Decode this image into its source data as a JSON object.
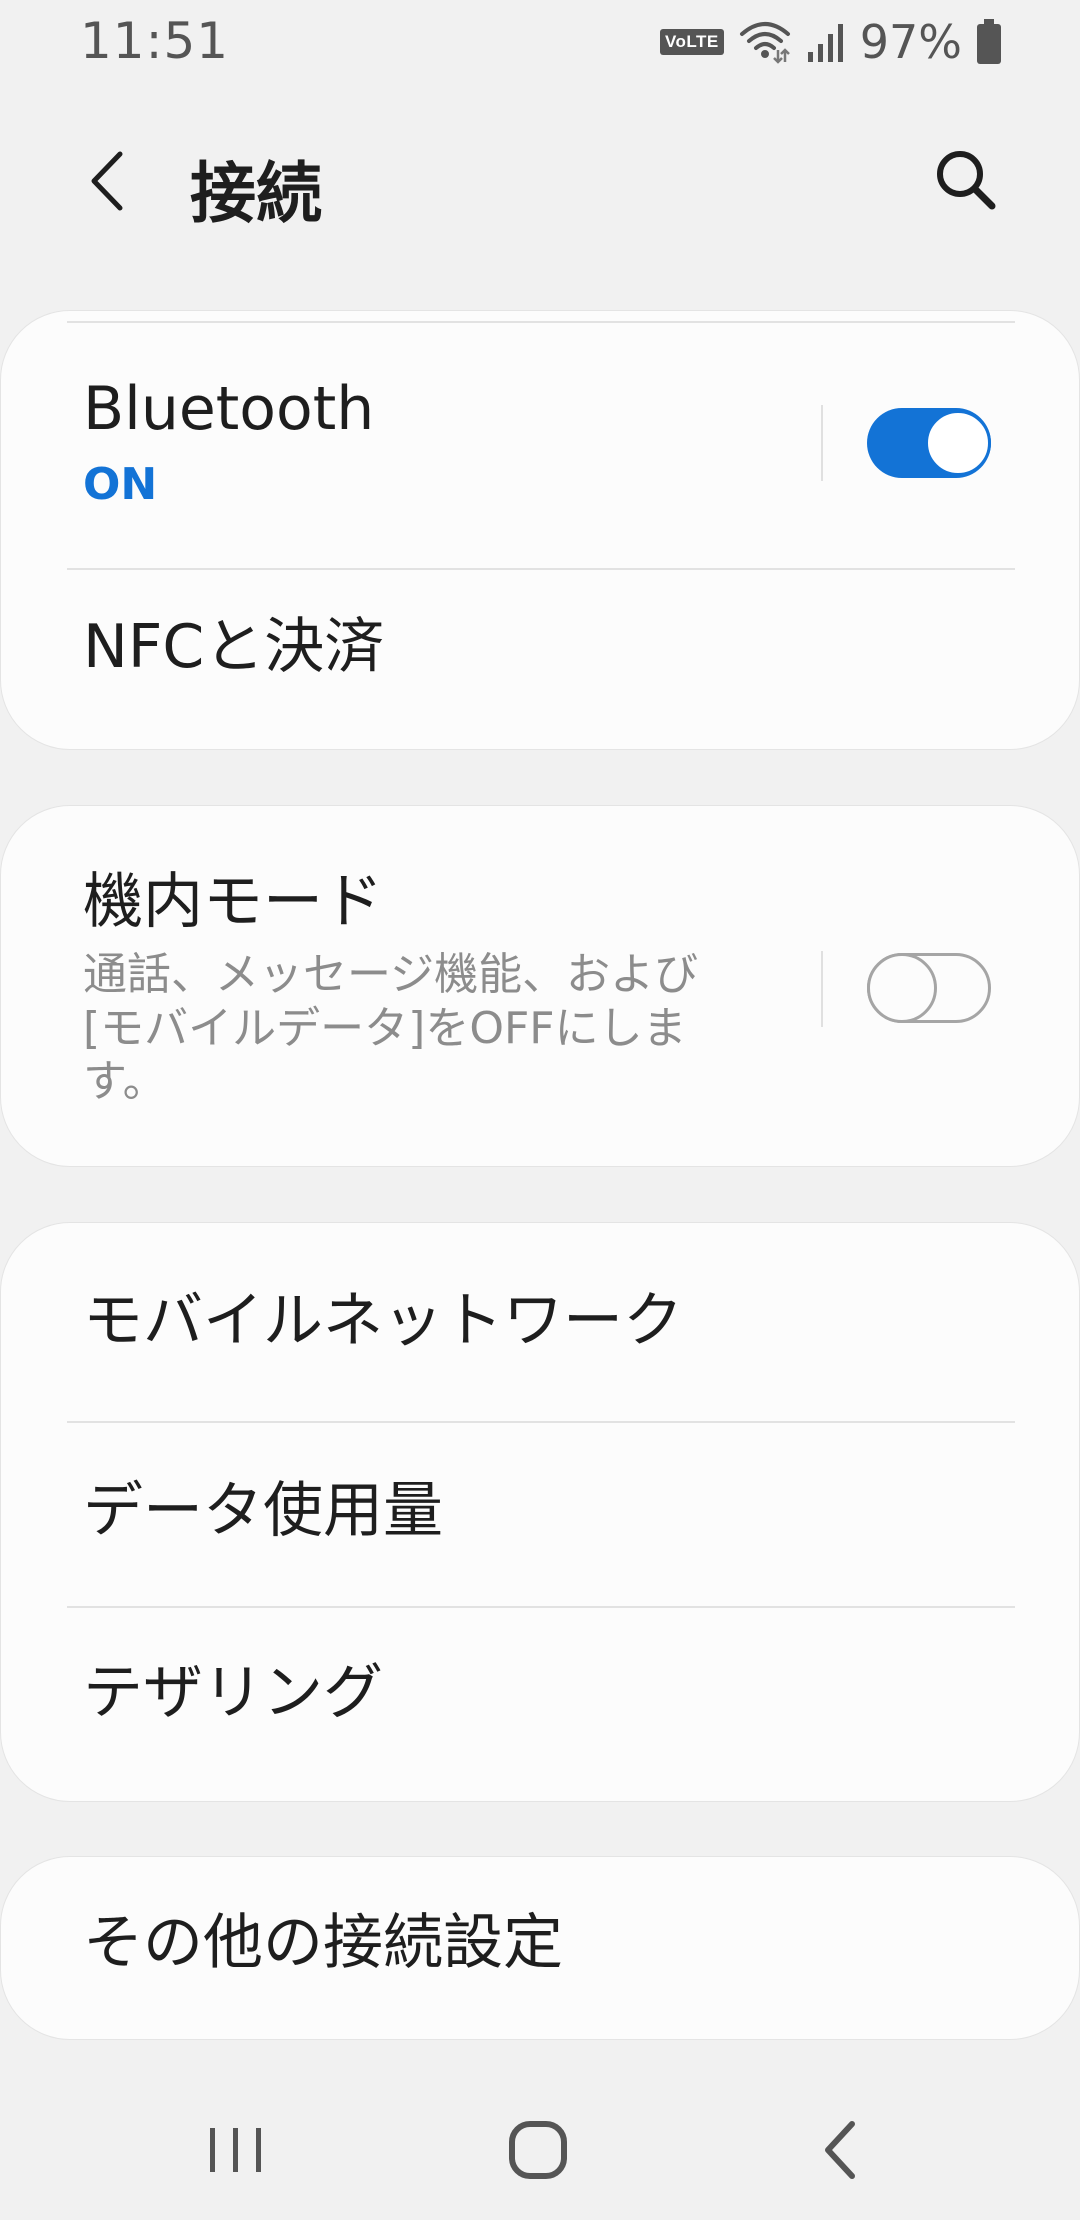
{
  "status_bar": {
    "time": "11:51",
    "volte": "VoLTE",
    "battery_percent": "97%",
    "icons": [
      "volte-icon",
      "wifi-icon",
      "signal-icon",
      "battery-icon"
    ]
  },
  "header": {
    "title": "接続",
    "back_icon": "back-arrow-icon",
    "search_icon": "search-icon"
  },
  "groups": [
    {
      "items": [
        {
          "title": "Bluetooth",
          "status": "ON",
          "toggle": true
        },
        {
          "title": "NFCと決済"
        }
      ]
    },
    {
      "items": [
        {
          "title": "機内モード",
          "description": "通話、メッセージ機能、および[モバイルデータ]をOFFにします。",
          "toggle": false
        }
      ]
    },
    {
      "items": [
        {
          "title": "モバイルネットワーク"
        },
        {
          "title": "データ使用量"
        },
        {
          "title": "テザリング"
        }
      ]
    },
    {
      "items": [
        {
          "title": "その他の接続設定"
        }
      ]
    }
  ],
  "nav_bar": {
    "icons": [
      "recent-apps-icon",
      "home-icon",
      "back-icon"
    ]
  },
  "colors": {
    "accent": "#1373d6",
    "background": "#f1f1f1",
    "card": "#fcfcfc"
  }
}
